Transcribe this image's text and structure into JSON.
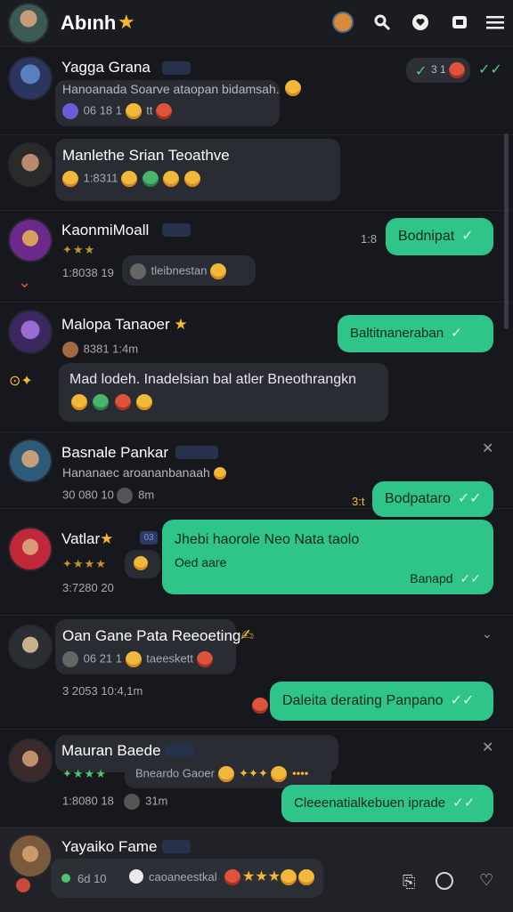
{
  "header": {
    "title": "Abınh"
  },
  "chats": [
    {
      "name": "Yagga Grana",
      "preview": "Hanoanada Soarve ataopan bidamsah.",
      "meta": "06 18 1",
      "meta2": "tt"
    },
    {
      "name": "Manlethe Srian Teoathve",
      "meta": "1:8311"
    },
    {
      "name": "KaonmiMoall",
      "time": "1:8",
      "reply": "Bodnipat",
      "meta": "1:8038 19",
      "meta2": "tleibnestan"
    },
    {
      "name": "Malopa Tanaoer",
      "reply": "Baltitnaneraban",
      "meta": "8381 1:4m",
      "bubble": "Mad lodeh. Inadelsian bal atler Bneothrangkn"
    },
    {
      "name": "Basnale Pankar",
      "preview": "Hananaec aroananbanaah",
      "meta": "30 080 10",
      "meta2": "8m",
      "time": "3:t",
      "reply": "Bodpataro"
    },
    {
      "name": "Vatlar",
      "badge": "03",
      "meta": "3:7280 20",
      "reply_line1": "Jhebi haorole Neo Nata taolo",
      "reply_line2": "Oed aare",
      "reply_footer": "Banapd"
    },
    {
      "name": "Oan Gane Pata Reeoeting",
      "meta": "3 2053 10:4,1m",
      "meta_inline": "06 21 1",
      "meta2": "taeeskett",
      "reply": "Daleita derating Panpano"
    },
    {
      "name": "Mauran Baede",
      "meta": "1:8080 18",
      "meta2": "31m",
      "sub": "Bneardo Gaoer",
      "reply": "Cleeenatialkebuen iprade"
    },
    {
      "name": "Yayaiko Fame",
      "meta": "6d 10",
      "sub": "caoaneestkal"
    }
  ],
  "topbar_right": {
    "meta": "3 1"
  }
}
